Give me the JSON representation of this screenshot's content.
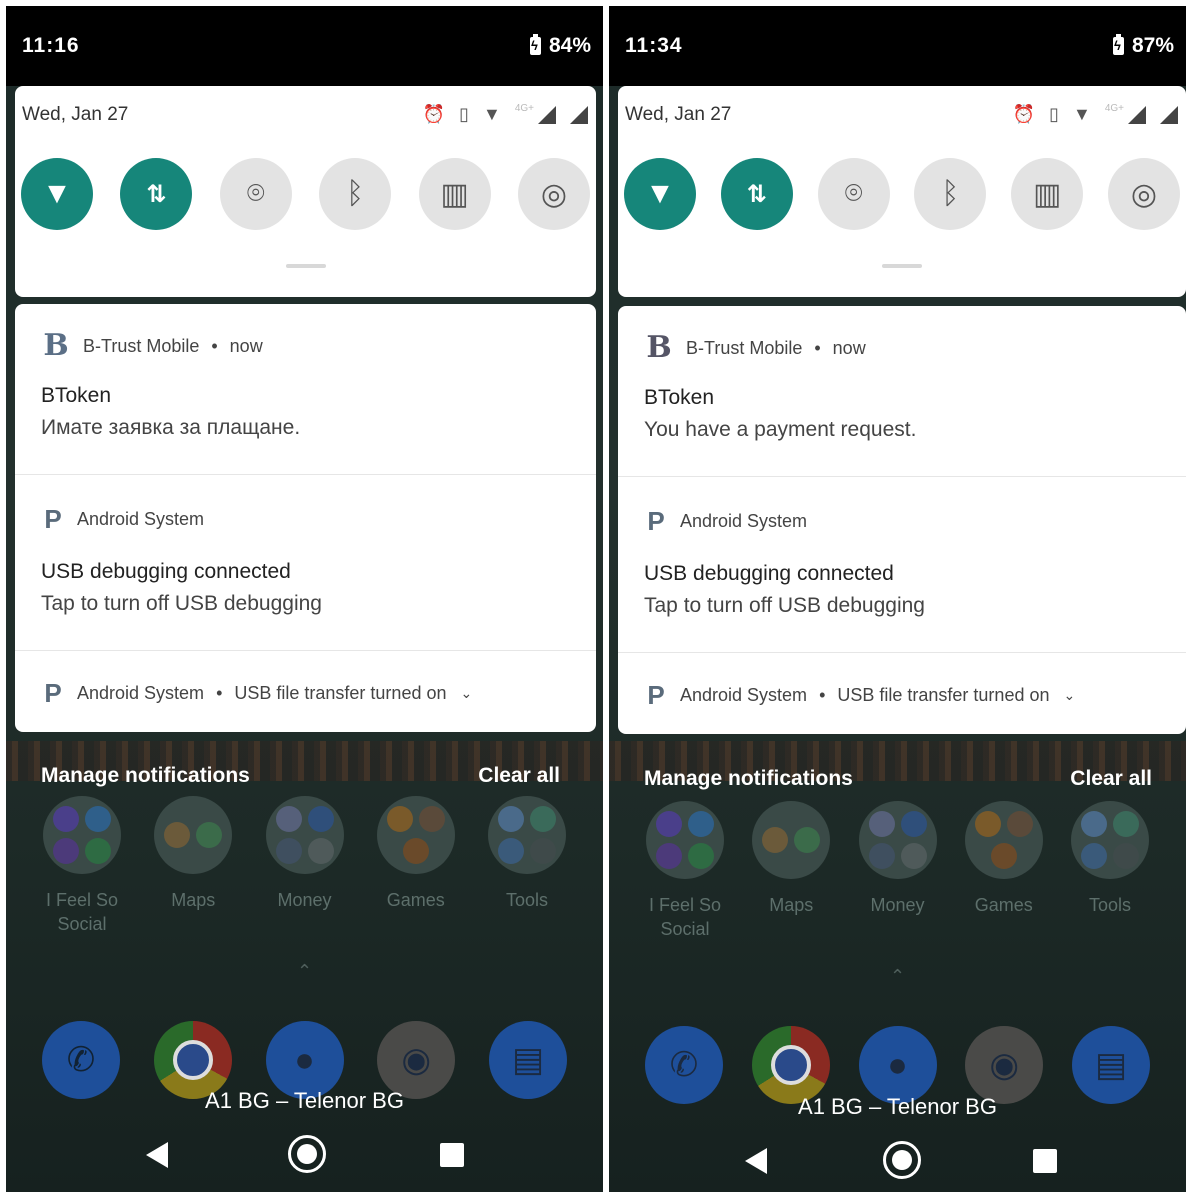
{
  "screens": [
    {
      "status": {
        "time": "11:16",
        "battery": "84%"
      },
      "qs": {
        "date": "Wed, Jan 27",
        "network_label": "4G+"
      },
      "notifications": [
        {
          "app": "B-Trust Mobile",
          "when": "now",
          "title": "BToken",
          "text": "Имате заявка за плащане."
        },
        {
          "app": "Android System",
          "title": "USB debugging connected",
          "text": "Tap to turn off USB debugging"
        },
        {
          "app": "Android System",
          "summary": "USB file transfer turned on"
        }
      ],
      "manage_label": "Manage notifications",
      "clear_all_label": "Clear all",
      "apps": [
        {
          "label": "I Feel So Social"
        },
        {
          "label": "Maps"
        },
        {
          "label": "Money"
        },
        {
          "label": "Games"
        },
        {
          "label": "Tools"
        }
      ],
      "carrier": "A1 BG – Telenor BG"
    },
    {
      "status": {
        "time": "11:34",
        "battery": "87%"
      },
      "qs": {
        "date": "Wed, Jan 27",
        "network_label": "4G+"
      },
      "notifications": [
        {
          "app": "B-Trust Mobile",
          "when": "now",
          "title": "BToken",
          "text": "You have a payment request."
        },
        {
          "app": "Android System",
          "title": "USB debugging connected",
          "text": "Tap to turn off USB debugging"
        },
        {
          "app": "Android System",
          "summary": "USB file transfer turned on"
        }
      ],
      "manage_label": "Manage notifications",
      "clear_all_label": "Clear all",
      "apps": [
        {
          "label": "I Feel So Social"
        },
        {
          "label": "Maps"
        },
        {
          "label": "Money"
        },
        {
          "label": "Games"
        },
        {
          "label": "Tools"
        }
      ],
      "carrier": "A1 BG – Telenor BG"
    }
  ],
  "separator": "•",
  "icons": {
    "wifi": "wifi-icon",
    "data": "mobile-data-icon",
    "location": "location-icon",
    "bluetooth": "bluetooth-icon",
    "flashlight": "flashlight-icon",
    "hotspot": "hotspot-icon",
    "alarm": "alarm-icon",
    "vibrate": "vibrate-icon",
    "battery": "battery-icon"
  },
  "colors": {
    "tile_on": "#16867a",
    "tile_off": "#e3e3e3",
    "btrust_logo": "#5b6f86"
  }
}
